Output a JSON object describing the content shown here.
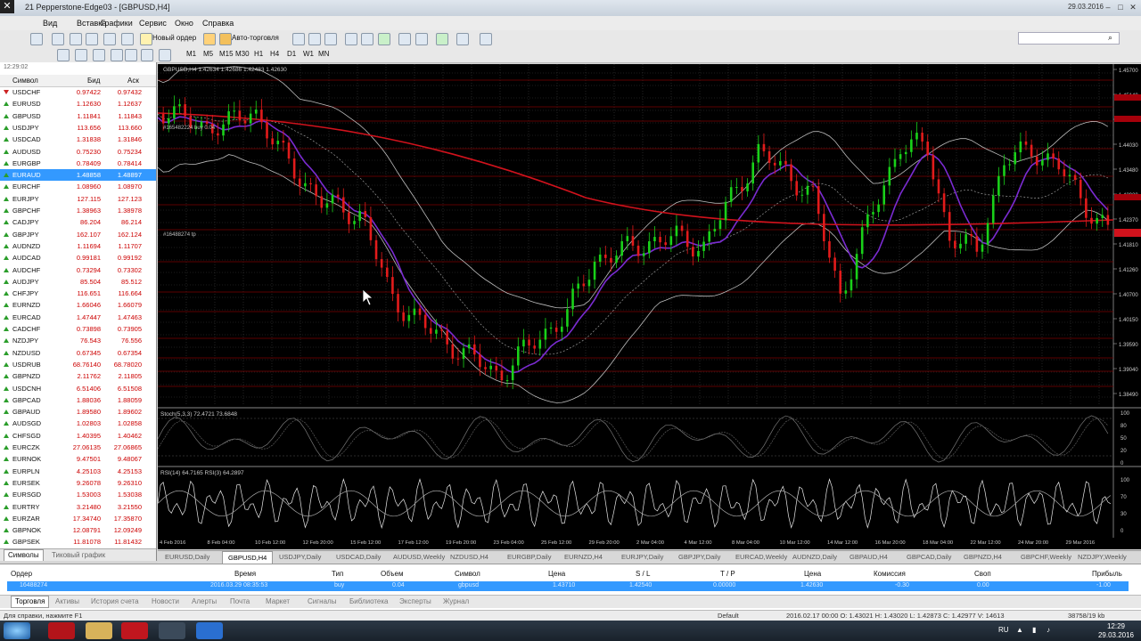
{
  "window": {
    "title": "21 Pepperstone-Edge03 - [GBPUSD,H4]",
    "date": "29.03.2016"
  },
  "menu": [
    "Вид",
    "Вставка",
    "Графики",
    "Сервис",
    "Окно",
    "Справка"
  ],
  "toolbar": {
    "new_order": "Новый ордер",
    "auto_trading": "Авто-торговля"
  },
  "timeframes": [
    "M1",
    "M5",
    "M15",
    "M30",
    "H1",
    "H4",
    "D1",
    "W1",
    "MN"
  ],
  "market_watch": {
    "header_time": "12:29:02",
    "col_symbol": "Символ",
    "col_bid": "Бид",
    "col_ask": "Аск",
    "rows": [
      {
        "symbol": "USDCHF",
        "bid": "0.97422",
        "ask": "0.97432",
        "dir": "down"
      },
      {
        "symbol": "EURUSD",
        "bid": "1.12630",
        "ask": "1.12637",
        "dir": "up"
      },
      {
        "symbol": "GBPUSD",
        "bid": "1.11841",
        "ask": "1.11843",
        "dir": "up"
      },
      {
        "symbol": "USDJPY",
        "bid": "113.656",
        "ask": "113.660",
        "dir": "up"
      },
      {
        "symbol": "USDCAD",
        "bid": "1.31838",
        "ask": "1.31846",
        "dir": "up"
      },
      {
        "symbol": "AUDUSD",
        "bid": "0.75230",
        "ask": "0.75234",
        "dir": "up"
      },
      {
        "symbol": "EURGBP",
        "bid": "0.78409",
        "ask": "0.78414",
        "dir": "up"
      },
      {
        "symbol": "EURAUD",
        "bid": "1.48858",
        "ask": "1.48897",
        "dir": "up",
        "selected": true
      },
      {
        "symbol": "EURCHF",
        "bid": "1.08960",
        "ask": "1.08970",
        "dir": "up"
      },
      {
        "symbol": "EURJPY",
        "bid": "127.115",
        "ask": "127.123",
        "dir": "up"
      },
      {
        "symbol": "GBPCHF",
        "bid": "1.38963",
        "ask": "1.38978",
        "dir": "up"
      },
      {
        "symbol": "CADJPY",
        "bid": "86.204",
        "ask": "86.214",
        "dir": "up"
      },
      {
        "symbol": "GBPJPY",
        "bid": "162.107",
        "ask": "162.124",
        "dir": "up"
      },
      {
        "symbol": "AUDNZD",
        "bid": "1.11694",
        "ask": "1.11707",
        "dir": "up"
      },
      {
        "symbol": "AUDCAD",
        "bid": "0.99181",
        "ask": "0.99192",
        "dir": "up"
      },
      {
        "symbol": "AUDCHF",
        "bid": "0.73294",
        "ask": "0.73302",
        "dir": "up"
      },
      {
        "symbol": "AUDJPY",
        "bid": "85.504",
        "ask": "85.512",
        "dir": "up"
      },
      {
        "symbol": "CHFJPY",
        "bid": "116.651",
        "ask": "116.664",
        "dir": "up"
      },
      {
        "symbol": "EURNZD",
        "bid": "1.66046",
        "ask": "1.66079",
        "dir": "up"
      },
      {
        "symbol": "EURCAD",
        "bid": "1.47447",
        "ask": "1.47463",
        "dir": "up"
      },
      {
        "symbol": "CADCHF",
        "bid": "0.73898",
        "ask": "0.73905",
        "dir": "up"
      },
      {
        "symbol": "NZDJPY",
        "bid": "76.543",
        "ask": "76.556",
        "dir": "up"
      },
      {
        "symbol": "NZDUSD",
        "bid": "0.67345",
        "ask": "0.67354",
        "dir": "up"
      },
      {
        "symbol": "USDRUB",
        "bid": "68.76140",
        "ask": "68.78020",
        "dir": "up"
      },
      {
        "symbol": "GBPNZD",
        "bid": "2.11762",
        "ask": "2.11805",
        "dir": "up"
      },
      {
        "symbol": "USDCNH",
        "bid": "6.51406",
        "ask": "6.51508",
        "dir": "up"
      },
      {
        "symbol": "GBPCAD",
        "bid": "1.88036",
        "ask": "1.88059",
        "dir": "up"
      },
      {
        "symbol": "GBPAUD",
        "bid": "1.89580",
        "ask": "1.89602",
        "dir": "up"
      },
      {
        "symbol": "AUDSGD",
        "bid": "1.02803",
        "ask": "1.02858",
        "dir": "up"
      },
      {
        "symbol": "CHFSGD",
        "bid": "1.40395",
        "ask": "1.40462",
        "dir": "up"
      },
      {
        "symbol": "EURCZK",
        "bid": "27.06135",
        "ask": "27.06865",
        "dir": "up"
      },
      {
        "symbol": "EURNOK",
        "bid": "9.47501",
        "ask": "9.48067",
        "dir": "up"
      },
      {
        "symbol": "EURPLN",
        "bid": "4.25103",
        "ask": "4.25153",
        "dir": "up"
      },
      {
        "symbol": "EURSEK",
        "bid": "9.26078",
        "ask": "9.26310",
        "dir": "up"
      },
      {
        "symbol": "EURSGD",
        "bid": "1.53003",
        "ask": "1.53038",
        "dir": "up"
      },
      {
        "symbol": "EURTRY",
        "bid": "3.21480",
        "ask": "3.21550",
        "dir": "up"
      },
      {
        "symbol": "EURZAR",
        "bid": "17.34740",
        "ask": "17.35870",
        "dir": "up"
      },
      {
        "symbol": "GBPNOK",
        "bid": "12.08791",
        "ask": "12.09249",
        "dir": "up"
      },
      {
        "symbol": "GBPSEK",
        "bid": "11.81078",
        "ask": "11.81432",
        "dir": "up"
      }
    ],
    "tab_symbols": "Символы",
    "tab_tick_chart": "Тиковый график"
  },
  "chart": {
    "main_label": "GBPUSD,H4  1.42634 1.42686 1.42483 1.42630",
    "order_label_1": "#165482224 buy 0.04",
    "order_label_2": "#16488274 tp",
    "stoch_label": "Stoch(5,3,3) 72.4721 73.6848",
    "rsi_label": "RSI(14) 64.7165  RSI(3) 64.2897",
    "price_scale": [
      "1.45700",
      "1.45140",
      "1.44590",
      "1.44030",
      "1.43480",
      "1.42920",
      "1.42370",
      "1.41810",
      "1.41260",
      "1.40700",
      "1.40150",
      "1.39590",
      "1.39040",
      "1.38490"
    ],
    "stoch_scale": [
      "100",
      "80",
      "50",
      "20",
      "0"
    ],
    "rsi_scale": [
      "100",
      "70",
      "30",
      "0"
    ],
    "time_axis": [
      "4 Feb 2016",
      "8 Feb 04:00",
      "10 Feb 12:00",
      "12 Feb 20:00",
      "15 Feb 12:00",
      "17 Feb 12:00",
      "19 Feb 20:00",
      "23 Feb 04:00",
      "25 Feb 12:00",
      "29 Feb 20:00",
      "2 Mar 04:00",
      "4 Mar 12:00",
      "8 Mar 04:00",
      "10 Mar 12:00",
      "14 Mar 12:00",
      "16 Mar 20:00",
      "18 Mar 04:00",
      "22 Mar 12:00",
      "24 Mar 20:00",
      "29 Mar 2016"
    ]
  },
  "chart_tabs": [
    "EURUSD,Daily",
    "GBPUSD,H4",
    "USDJPY,Daily",
    "USDCAD,Daily",
    "AUDUSD,Weekly",
    "NZDUSD,H4",
    "EURGBP,Daily",
    "EURNZD,H4",
    "EURJPY,Daily",
    "GBPJPY,Daily",
    "EURCAD,Weekly",
    "AUDNZD,Daily",
    "GBPAUD,H4",
    "GBPCAD,Daily",
    "GBPNZD,H4",
    "GBPCHF,Weekly",
    "NZDJPY,Weekly"
  ],
  "trade": {
    "headers": [
      "Ордер",
      "Время",
      "Тип",
      "Объем",
      "Символ",
      "Цена",
      "S / L",
      "T / P",
      "Цена",
      "Комиссия",
      "Своп",
      "Прибыль"
    ],
    "row": [
      "16488274",
      "2016.03.29 08:35:53",
      "buy",
      "0.04",
      "gbpusd",
      "1.43710",
      "1.42540",
      "0.00000",
      "1.42630",
      "-0.30",
      "0.00",
      "-1.00"
    ],
    "tabs": [
      "Торговля",
      "Активы",
      "История счета",
      "Новости",
      "Алерты",
      "Почта",
      "Маркет",
      "Сигналы",
      "Библиотека",
      "Эксперты",
      "Журнал"
    ]
  },
  "status": {
    "hint": "Для справки, нажмите F1",
    "profile": "Default",
    "ohlc": "2016.02.17 00:00   O: 1.43021   H: 1.43020   L: 1.42873   C: 1.42977   V: 14613",
    "traffic": "38758/19 kb"
  },
  "taskbar": {
    "lang": "RU",
    "time": "12:29",
    "date": "29.03.2016"
  }
}
